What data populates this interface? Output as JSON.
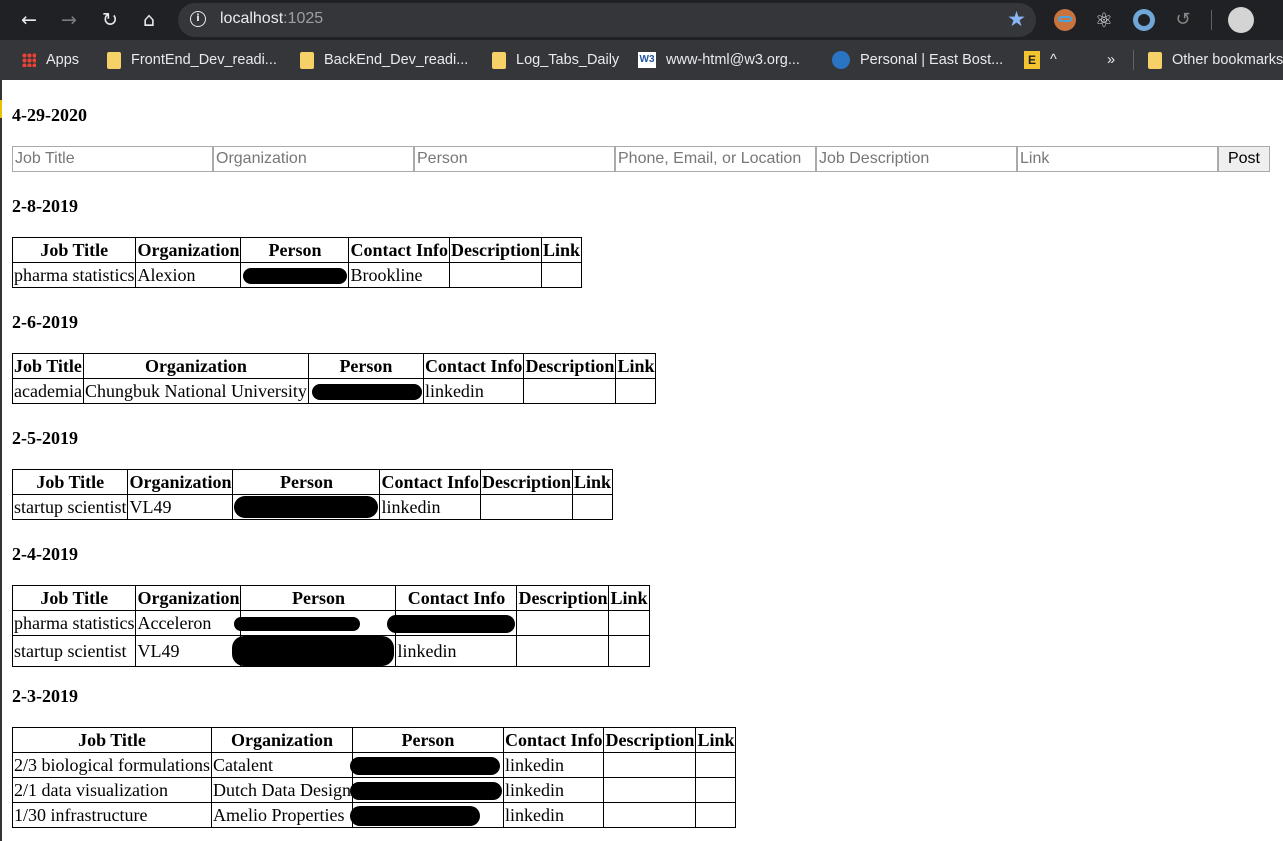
{
  "browser": {
    "url_host": "localhost",
    "url_port": ":1025",
    "bookmarks": [
      {
        "label": "Apps",
        "icon": "apps-grid-icon"
      },
      {
        "label": "FrontEnd_Dev_readi...",
        "icon": "folder-icon"
      },
      {
        "label": "BackEnd_Dev_readi...",
        "icon": "folder-icon"
      },
      {
        "label": "Log_Tabs_Daily",
        "icon": "folder-icon"
      },
      {
        "label": "www-html@w3.org...",
        "icon": "w3c-icon"
      },
      {
        "label": "Personal | East Bost...",
        "icon": "globe-icon"
      },
      {
        "label": "^",
        "icon": "evernote-icon"
      },
      {
        "label": "»",
        "icon": ""
      },
      {
        "label": "Other bookmarks",
        "icon": "folder-icon"
      }
    ],
    "accent_color": "#8ab4f8"
  },
  "page": {
    "post_date": "4-29-2020",
    "form": {
      "placeholders": [
        "Job Title",
        "Organization",
        "Person",
        "Phone, Email, or Location",
        "Job Description",
        "Link"
      ],
      "post_label": "Post"
    },
    "headers": [
      "Job Title",
      "Organization",
      "Person",
      "Contact Info",
      "Description",
      "Link"
    ],
    "groups": [
      {
        "date": "2-8-2019",
        "rows": [
          {
            "job_title": "pharma statistics",
            "organization": "Alexion",
            "person": "[redacted]",
            "contact": "Brookline",
            "description": "",
            "link": ""
          }
        ]
      },
      {
        "date": "2-6-2019",
        "rows": [
          {
            "job_title": "academia",
            "organization": "Chungbuk National University",
            "person": "[redacted]",
            "contact": "linkedin",
            "description": "",
            "link": ""
          }
        ]
      },
      {
        "date": "2-5-2019",
        "rows": [
          {
            "job_title": "startup scientist",
            "organization": "VL49",
            "person": "[redacted]",
            "contact": "linkedin",
            "description": "",
            "link": ""
          }
        ]
      },
      {
        "date": "2-4-2019",
        "rows": [
          {
            "job_title": "pharma statistics",
            "organization": "Acceleron",
            "person": "[redacted]",
            "contact": "[redacted]",
            "description": "",
            "link": ""
          },
          {
            "job_title": "startup scientist",
            "organization": "VL49",
            "person": "[redacted]",
            "contact": "linkedin",
            "description": "",
            "link": ""
          }
        ]
      },
      {
        "date": "2-3-2019",
        "rows": [
          {
            "job_title": "2/3 biological formulations",
            "organization": "Catalent",
            "person": "[redacted]",
            "contact": "linkedin",
            "description": "",
            "link": ""
          },
          {
            "job_title": "2/1 data visualization",
            "organization": "Dutch Data Design",
            "person": "[redacted]",
            "contact": "linkedin",
            "description": "",
            "link": ""
          },
          {
            "job_title": "1/30 infrastructure",
            "organization": "Amelio Properties",
            "person": "[redacted]",
            "contact": "linkedin",
            "description": "",
            "link": ""
          }
        ]
      }
    ]
  }
}
